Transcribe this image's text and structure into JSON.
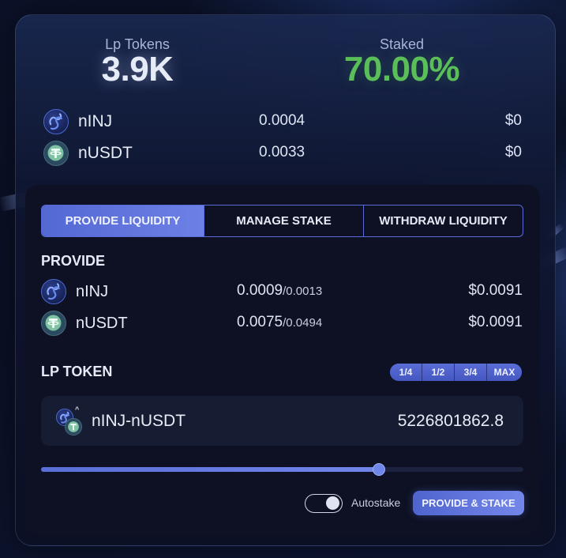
{
  "header": {
    "lp_tokens_label": "Lp Tokens",
    "lp_tokens_value": "3.9K",
    "staked_label": "Staked",
    "staked_value": "70.00%"
  },
  "pool_assets": [
    {
      "symbol": "nINJ",
      "amount": "0.0004",
      "usd": "$0",
      "icon": "injective-icon"
    },
    {
      "symbol": "nUSDT",
      "amount": "0.0033",
      "usd": "$0",
      "icon": "tether-icon"
    }
  ],
  "tabs": [
    {
      "label": "PROVIDE LIQUIDITY",
      "active": true
    },
    {
      "label": "MANAGE STAKE",
      "active": false
    },
    {
      "label": "WITHDRAW LIQUIDITY",
      "active": false
    }
  ],
  "provide": {
    "title": "PROVIDE",
    "rows": [
      {
        "symbol": "nINJ",
        "amount": "0.0009",
        "max": "/0.0013",
        "usd": "$0.0091"
      },
      {
        "symbol": "nUSDT",
        "amount": "0.0075",
        "max": "/0.0494",
        "usd": "$0.0091"
      }
    ]
  },
  "lp_token": {
    "title": "LP TOKEN",
    "fractions": [
      "1/4",
      "1/2",
      "3/4",
      "MAX"
    ],
    "pair": "nINJ-nUSDT",
    "amount": "5226801862.8",
    "slider_fraction": 0.7
  },
  "autostake_label": "Autostake",
  "autostake_on": true,
  "cta_label": "PROVIDE & STAKE",
  "colors": {
    "accent": "#5b70dc",
    "staked_green": "#5bbf59",
    "background": "#0b1127"
  }
}
